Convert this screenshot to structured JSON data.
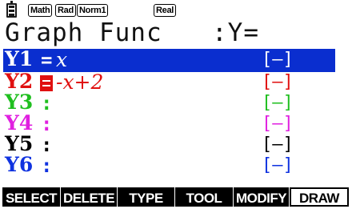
{
  "status_bar": {
    "battery_icon": "battery-icon",
    "mode_badges": [
      "Math",
      "Rad",
      "Norm1"
    ],
    "complex_mode": "Real"
  },
  "header": {
    "title": "Graph Func",
    "mode_label": ":Y="
  },
  "functions": [
    {
      "name": "Y1",
      "equals": "=",
      "expression": "x",
      "line_style": "[—]",
      "color": "#ffffff",
      "style_color": "#ffffff",
      "selected": true
    },
    {
      "name": "Y2",
      "equals": "=",
      "expression": "-x+2",
      "line_style": "[—]",
      "color": "#e01010",
      "style_color": "#e01010",
      "selected": false
    },
    {
      "name": "Y3",
      "equals": ":",
      "expression": "",
      "line_style": "[—]",
      "color": "#1fbf1f",
      "style_color": "#1fbf1f",
      "selected": false
    },
    {
      "name": "Y4",
      "equals": ":",
      "expression": "",
      "line_style": "[—]",
      "color": "#e020e0",
      "style_color": "#e020e0",
      "selected": false
    },
    {
      "name": "Y5",
      "equals": ":",
      "expression": "",
      "line_style": "[—]",
      "color": "#000000",
      "style_color": "#000000",
      "selected": false
    },
    {
      "name": "Y6",
      "equals": ":",
      "expression": "",
      "line_style": "[—]",
      "color": "#1033e0",
      "style_color": "#1033e0",
      "selected": false
    }
  ],
  "function_keys": [
    {
      "label": "SELECT",
      "style": "inv"
    },
    {
      "label": "DELETE",
      "style": "inv"
    },
    {
      "label": "TYPE",
      "style": "inv"
    },
    {
      "label": "TOOL",
      "style": "inv"
    },
    {
      "label": "MODIFY",
      "style": "inv"
    },
    {
      "label": "DRAW",
      "style": "out"
    }
  ],
  "colors": {
    "selection_bar": "#0a2ecf",
    "cursor_box": "#e01010"
  }
}
